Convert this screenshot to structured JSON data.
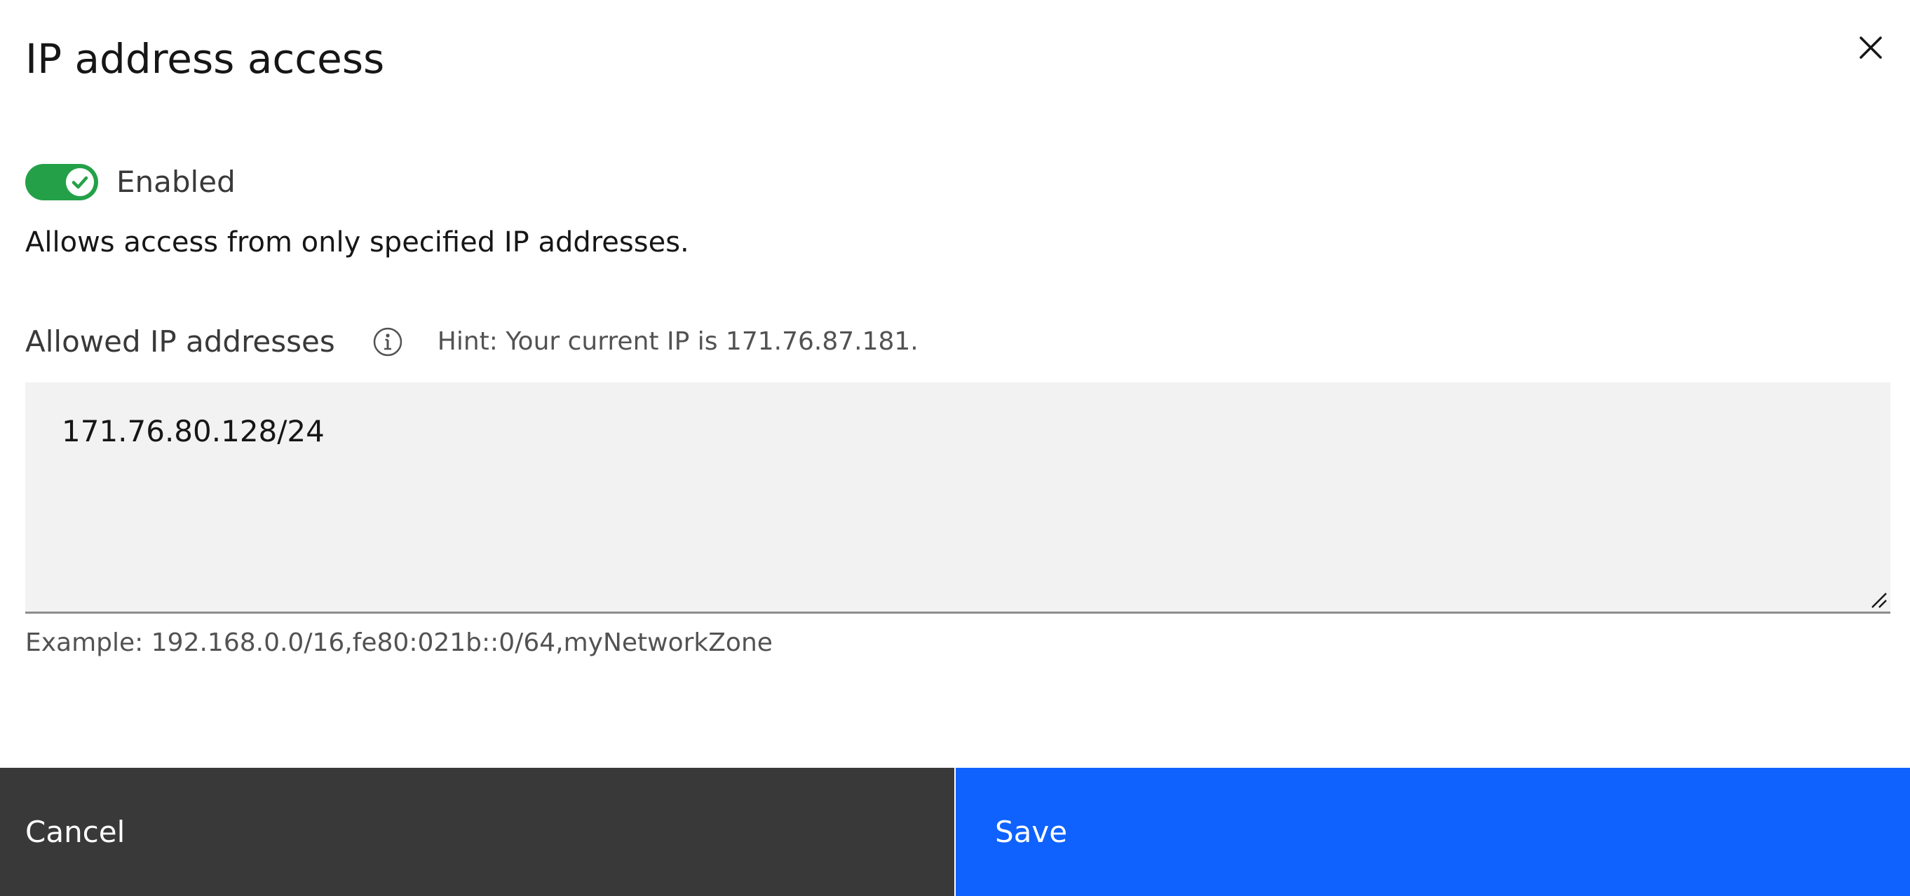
{
  "modal": {
    "title": "IP address access",
    "close_icon": "close-icon"
  },
  "toggle": {
    "state": "on",
    "label": "Enabled",
    "color": "#24a148"
  },
  "description": "Allows access from only specified IP addresses.",
  "field": {
    "label": "Allowed IP addresses",
    "info_icon": "info-icon",
    "hint": "Hint: Your current IP is 171.76.87.181.",
    "value": "171.76.80.128/24",
    "helper": "Example: 192.168.0.0/16,fe80:021b::0/64,myNetworkZone"
  },
  "footer": {
    "cancel_label": "Cancel",
    "save_label": "Save",
    "save_color": "#0f62fe",
    "cancel_color": "#393939"
  }
}
